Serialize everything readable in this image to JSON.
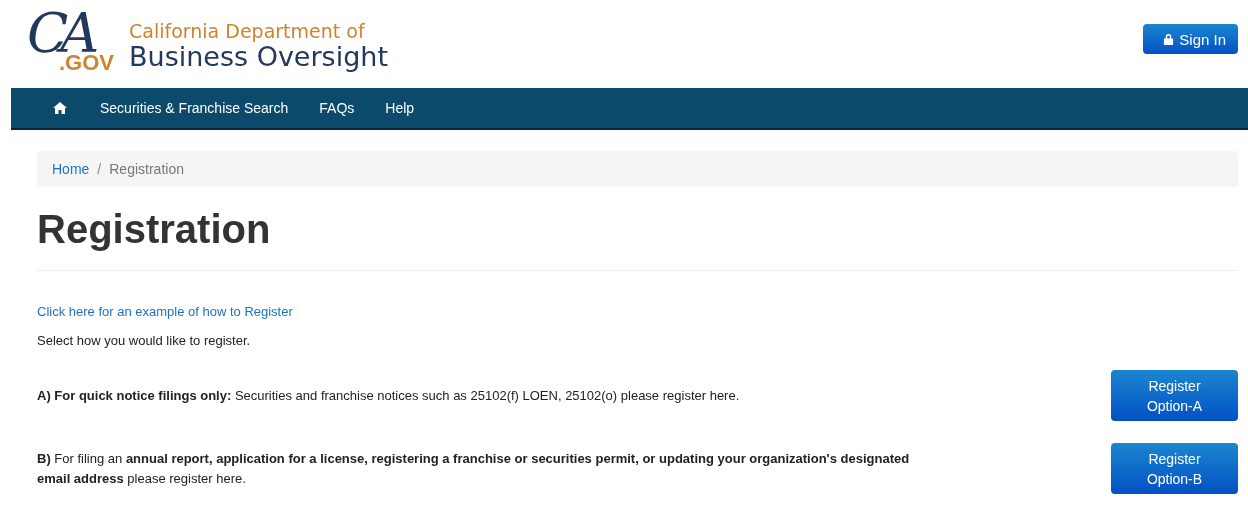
{
  "logo": {
    "mark": "CA",
    "suffix": ".GOV",
    "line_1": "California Department of",
    "line_2": "Business Oversight"
  },
  "sign_in": {
    "label": "Sign In"
  },
  "nav": {
    "items": [
      {
        "label": "Securities & Franchise Search"
      },
      {
        "label": "FAQs"
      },
      {
        "label": "Help"
      }
    ]
  },
  "breadcrumb": [
    {
      "label": "Home",
      "link": true
    },
    {
      "label": "Registration",
      "link": false,
      "separator": "/"
    }
  ],
  "heading": "Registration",
  "example_link": "Click here for an example of how to Register",
  "instruction": "Select how you would like to register.",
  "options": [
    {
      "text": "**A) For quick notice filings only:** Securities and franchise notices such as 25102(f) LOEN, 25102(o) please register here.",
      "button": [
        "Register",
        "Option-A"
      ]
    },
    {
      "text": "**B)** For filing an **annual report, application for a license, registering a franchise or securities permit, or updating your organization's designated email address** please register here.",
      "button": [
        "Register",
        "Option-B"
      ]
    }
  ]
}
